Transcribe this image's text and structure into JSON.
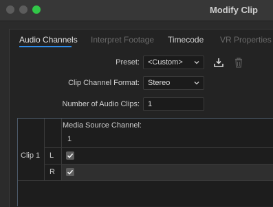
{
  "window": {
    "title": "Modify Clip"
  },
  "tabs": [
    {
      "label": "Audio Channels",
      "state": "active"
    },
    {
      "label": "Interpret Footage",
      "state": "disabled"
    },
    {
      "label": "Timecode",
      "state": "normal"
    },
    {
      "label": "VR Properties",
      "state": "disabled"
    }
  ],
  "form": {
    "preset_label": "Preset:",
    "preset_value": "<Custom>",
    "format_label": "Clip Channel Format:",
    "format_value": "Stereo",
    "clips_label": "Number of Audio Clips:",
    "clips_value": "1"
  },
  "grid": {
    "header": "Media Source Channel:",
    "column": "1",
    "clip_label": "Clip 1",
    "rows": [
      {
        "channel": "L",
        "checked": true
      },
      {
        "channel": "R",
        "checked": true
      }
    ]
  },
  "colors": {
    "accent": "#2d8ceb",
    "maximize": "#31c748"
  },
  "icons": [
    "save-preset-icon",
    "delete-preset-icon",
    "chevron-down-icon",
    "checkmark-icon"
  ]
}
